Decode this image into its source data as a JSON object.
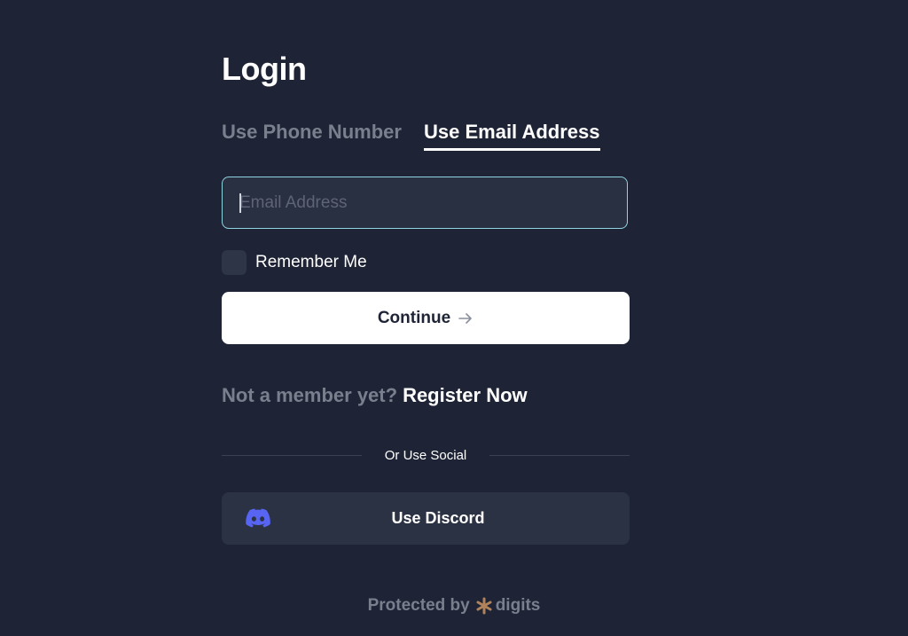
{
  "login": {
    "title": "Login",
    "tabs": [
      {
        "label": "Use Phone Number",
        "active": false
      },
      {
        "label": "Use Email Address",
        "active": true
      }
    ],
    "email": {
      "placeholder": "Email Address",
      "value": ""
    },
    "remember_label": "Remember Me",
    "continue_label": "Continue",
    "register_prompt": "Not a member yet?",
    "register_link": "Register Now",
    "divider_text": "Or Use Social",
    "social_button_label": "Use Discord",
    "social_icon": "discord-icon"
  },
  "footer": {
    "protected_text": "Protected by",
    "brand": "digits",
    "brand_icon": "digits-logo-icon"
  },
  "colors": {
    "background": "#1e2435",
    "input_border": "#8fd3e0",
    "discord": "#5865f2",
    "muted_text": "#7a7f8e",
    "digits_mark": "#b0835a"
  }
}
